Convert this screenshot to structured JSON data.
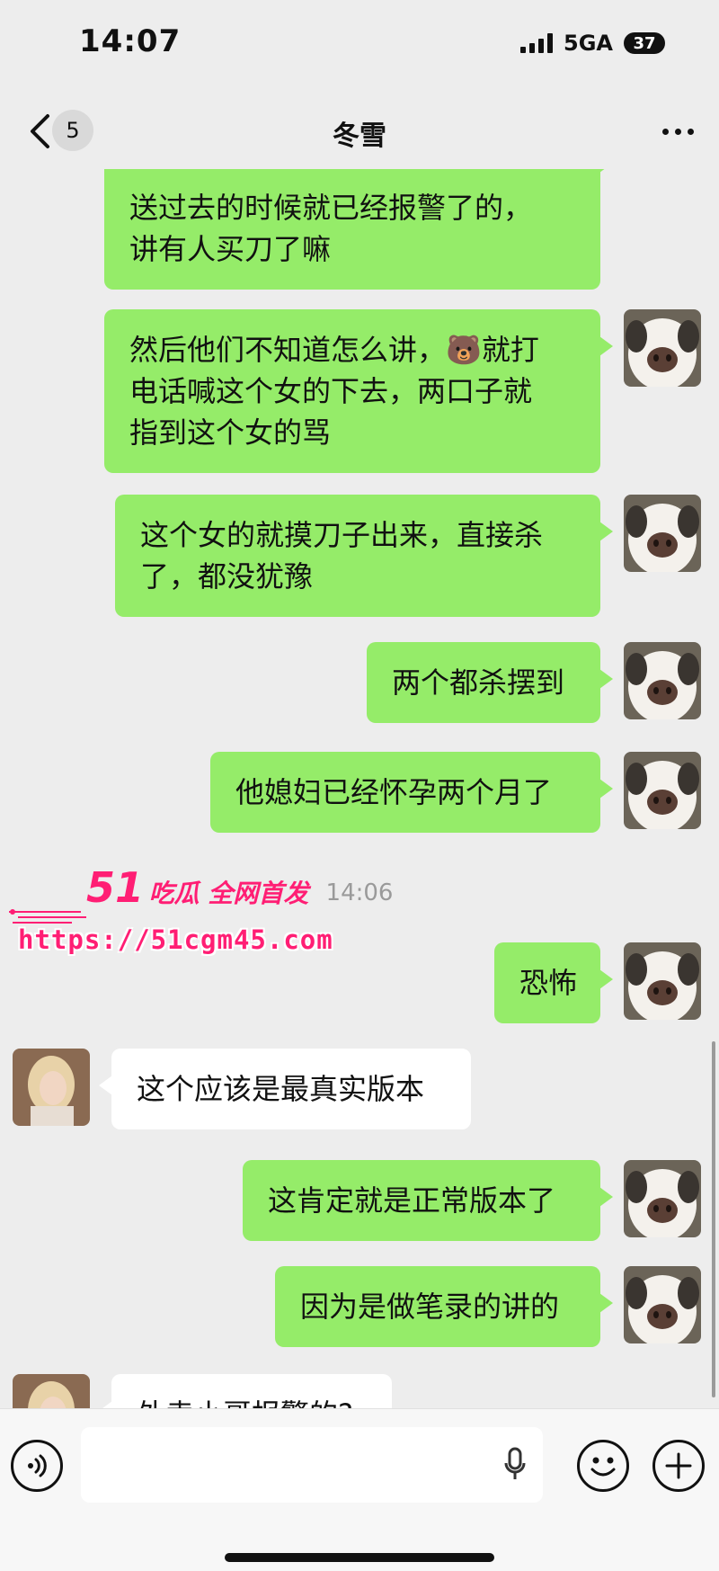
{
  "status_bar": {
    "time": "14:07",
    "network": "5GA",
    "battery": "37"
  },
  "nav": {
    "unread_count": "5",
    "title": "冬雪",
    "icons": [
      "chevron-left-icon",
      "more-icon"
    ]
  },
  "messages": [
    {
      "sender": "self",
      "lines": [
        "送过去的时候就已经报警了的，",
        "讲有人买刀了嘛"
      ]
    },
    {
      "sender": "self",
      "lines": [
        "然后他们不知道怎么讲，🐻就打",
        "电话喊这个女的下去，两口子就",
        "指到这个女的骂"
      ]
    },
    {
      "sender": "self",
      "lines": [
        "这个女的就摸刀子出来，直接杀",
        "了，都没犹豫"
      ]
    },
    {
      "sender": "self",
      "lines": [
        "两个都杀摆到"
      ]
    },
    {
      "sender": "self",
      "lines": [
        "他媳妇已经怀孕两个月了"
      ]
    },
    {
      "sender": "self",
      "lines": [
        "恐怖"
      ]
    },
    {
      "sender": "other",
      "lines": [
        "这个应该是最真实版本"
      ]
    },
    {
      "sender": "self",
      "lines": [
        "这肯定就是正常版本了"
      ]
    },
    {
      "sender": "self",
      "lines": [
        "因为是做笔录的讲的"
      ]
    },
    {
      "sender": "other",
      "lines": [
        "外卖小哥报警的?"
      ]
    }
  ],
  "time_divider": "14:06",
  "watermark": {
    "number": "51",
    "text": "吃瓜 全网首发",
    "url": "https://51cgm45.com"
  },
  "input_bar": {
    "icons": [
      "voice-icon",
      "mic-icon",
      "emoji-icon",
      "plus-icon"
    ]
  },
  "colors": {
    "background": "#ededed",
    "self_bubble": "#95ec69",
    "other_bubble": "#ffffff",
    "watermark": "#ff1e74"
  }
}
